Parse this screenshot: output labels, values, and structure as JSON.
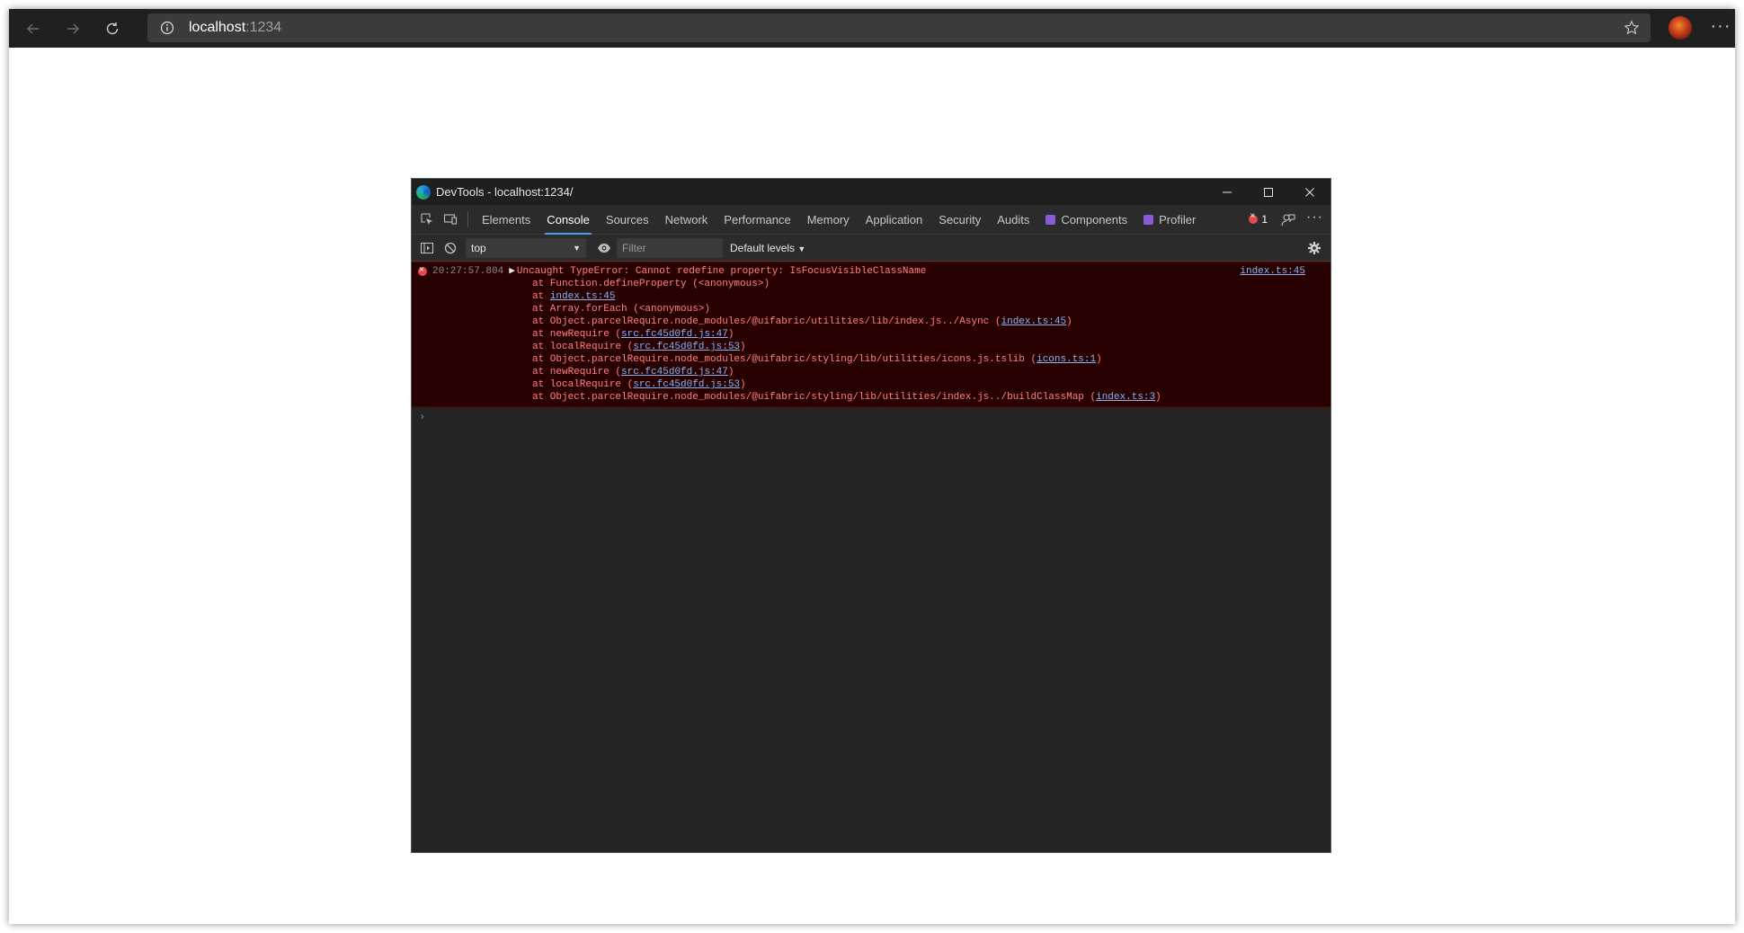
{
  "browser": {
    "url_host": "localhost",
    "url_port": ":1234"
  },
  "devtools": {
    "title": "DevTools - localhost:1234/",
    "tabs": [
      {
        "label": "Elements",
        "active": false
      },
      {
        "label": "Console",
        "active": true
      },
      {
        "label": "Sources",
        "active": false
      },
      {
        "label": "Network",
        "active": false
      },
      {
        "label": "Performance",
        "active": false
      },
      {
        "label": "Memory",
        "active": false
      },
      {
        "label": "Application",
        "active": false
      },
      {
        "label": "Security",
        "active": false
      },
      {
        "label": "Audits",
        "active": false
      },
      {
        "label": "Components",
        "active": false
      },
      {
        "label": "Profiler",
        "active": false
      }
    ],
    "error_count": "1",
    "toolbar": {
      "context": "top",
      "filter_placeholder": "Filter",
      "levels": "Default levels"
    },
    "console": {
      "error": {
        "timestamp": "20:27:57.804",
        "message": "Uncaught TypeError: Cannot redefine property: IsFocusVisibleClassName",
        "source": "index.ts:45",
        "stack": [
          {
            "prefix": "at Function.defineProperty (<anonymous>)",
            "link": "",
            "suffix": ""
          },
          {
            "prefix": "at ",
            "link": "index.ts:45",
            "suffix": ""
          },
          {
            "prefix": "at Array.forEach (<anonymous>)",
            "link": "",
            "suffix": ""
          },
          {
            "prefix": "at Object.parcelRequire.node_modules/@uifabric/utilities/lib/index.js../Async (",
            "link": "index.ts:45",
            "suffix": ")"
          },
          {
            "prefix": "at newRequire (",
            "link": "src.fc45d0fd.js:47",
            "suffix": ")"
          },
          {
            "prefix": "at localRequire (",
            "link": "src.fc45d0fd.js:53",
            "suffix": ")"
          },
          {
            "prefix": "at Object.parcelRequire.node_modules/@uifabric/styling/lib/utilities/icons.js.tslib (",
            "link": "icons.ts:1",
            "suffix": ")"
          },
          {
            "prefix": "at newRequire (",
            "link": "src.fc45d0fd.js:47",
            "suffix": ")"
          },
          {
            "prefix": "at localRequire (",
            "link": "src.fc45d0fd.js:53",
            "suffix": ")"
          },
          {
            "prefix": "at Object.parcelRequire.node_modules/@uifabric/styling/lib/utilities/index.js../buildClassMap (",
            "link": "index.ts:3",
            "suffix": ")"
          }
        ]
      },
      "prompt": "›"
    }
  }
}
